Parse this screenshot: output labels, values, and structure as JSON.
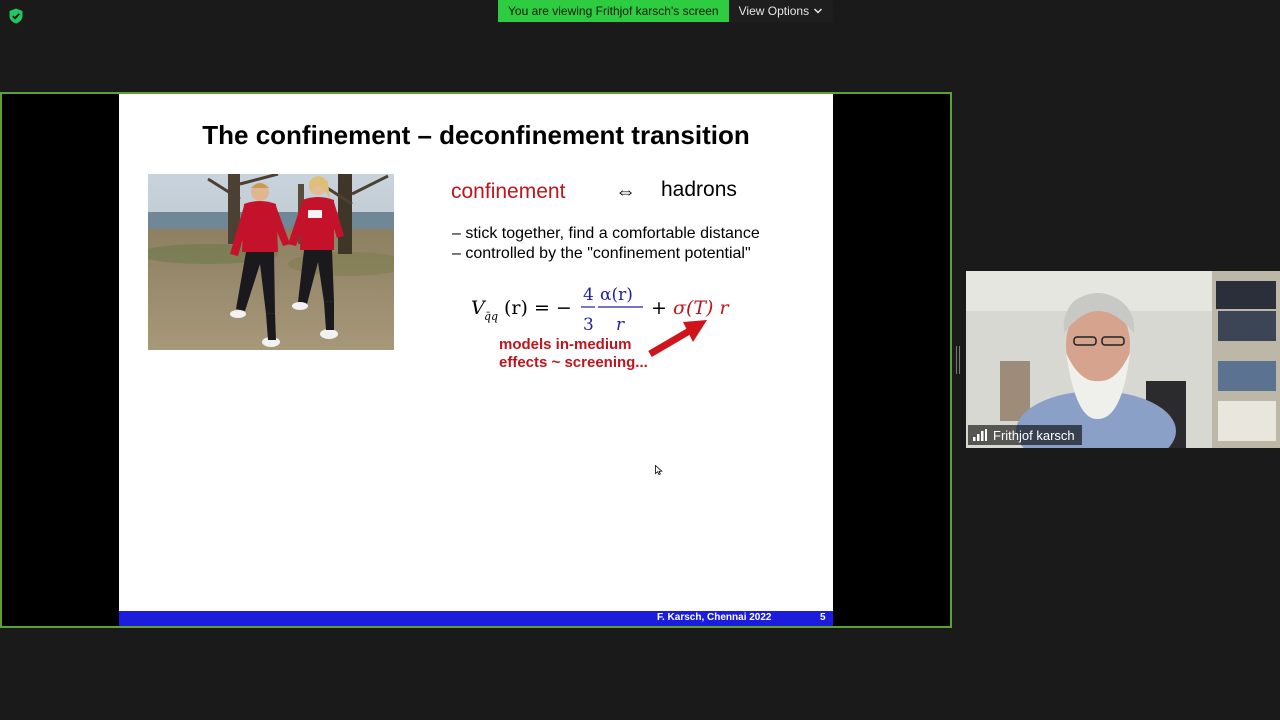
{
  "app": {
    "banner_text": "You are viewing Frithjof karsch's screen",
    "view_options_label": "View Options",
    "accent_green": "#2ecc40",
    "share_border": "#5fa032"
  },
  "slide": {
    "title": "The confinement – deconfinement transition",
    "confinement": "confinement",
    "equiv_symbol": "⇔",
    "hadrons": "hadrons",
    "bullets": [
      "– stick together, find  a comfortable distance",
      "– controlled by the \"confinement potential\""
    ],
    "formula": {
      "lhs": "V",
      "lhs_sub": "q̄q",
      "lhs_arg": "(r) = −",
      "frac1_num": "4",
      "frac1_den": "3",
      "frac2_num": "α(r)",
      "frac2_den": "r",
      "plus": "+",
      "sigma_term": "σ(T) r"
    },
    "red_note": [
      "models in-medium",
      "effects ~ screening..."
    ],
    "footer_author": "F. Karsch, Chennai  2022",
    "page_number": "5",
    "title_color": "#000000",
    "accent_red": "#c0141c",
    "footer_color": "#1c1cdc"
  },
  "participant": {
    "name": "Frithjof karsch"
  }
}
